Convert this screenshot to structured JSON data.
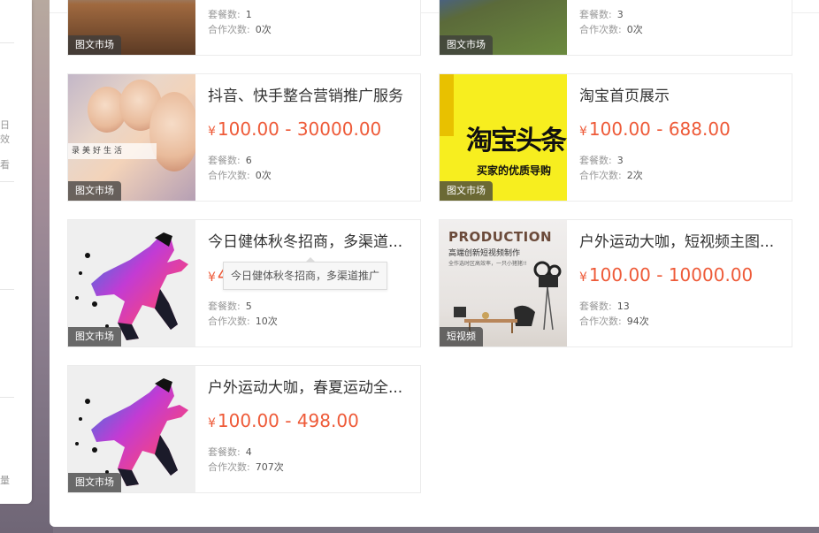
{
  "side_glyphs": [
    "日",
    "效",
    "看",
    "量"
  ],
  "colors": {
    "accent": "#ee5a38",
    "tag_bg": "#3c3c3c"
  },
  "products": [
    {
      "title": "",
      "price": "",
      "yen": "",
      "package_label": "套餐数:",
      "package_count": "1",
      "coop_label": "合作次数:",
      "coop_count": "0次",
      "tag": "图文市场",
      "image": "mountain"
    },
    {
      "title": "",
      "price": "",
      "yen": "",
      "package_label": "套餐数:",
      "package_count": "3",
      "coop_label": "合作次数:",
      "coop_count": "0次",
      "tag": "图文市场",
      "image": "field"
    },
    {
      "title": "抖音、快手整合营销推广服务",
      "yen": "¥",
      "price": "100.00 - 30000.00",
      "package_label": "套餐数:",
      "package_count": "6",
      "coop_label": "合作次数:",
      "coop_count": "0次",
      "tag": "图文市场",
      "image": "girls",
      "image_text": "录美好生活"
    },
    {
      "title": "淘宝首页展示",
      "yen": "¥",
      "price": "100.00 - 688.00",
      "package_label": "套餐数:",
      "package_count": "3",
      "coop_label": "合作次数:",
      "coop_count": "2次",
      "tag": "图文市场",
      "image": "taobao",
      "image_text": "淘宝头条",
      "image_sub": "买家的优质导购"
    },
    {
      "title": "今日健体秋冬招商，多渠道...",
      "yen": "¥",
      "price": "4",
      "package_label": "套餐数:",
      "package_count": "5",
      "coop_label": "合作次数:",
      "coop_count": "10次",
      "tag": "图文市场",
      "image": "runner"
    },
    {
      "title": "户外运动大咖，短视频主图...",
      "yen": "¥",
      "price": "100.00 - 10000.00",
      "package_label": "套餐数:",
      "package_count": "13",
      "coop_label": "合作次数:",
      "coop_count": "94次",
      "tag": "短视频",
      "image": "production",
      "image_text": "PRODUCTION",
      "image_sub": "高端创新短视频制作",
      "image_sub2": "全作选时区高效率，一只小猪猪!!"
    },
    {
      "title": "户外运动大咖，春夏运动全...",
      "yen": "¥",
      "price": "100.00 - 498.00",
      "package_label": "套餐数:",
      "package_count": "4",
      "coop_label": "合作次数:",
      "coop_count": "707次",
      "tag": "图文市场",
      "image": "runner"
    }
  ],
  "tooltip": "今日健体秋冬招商，多渠道推广"
}
